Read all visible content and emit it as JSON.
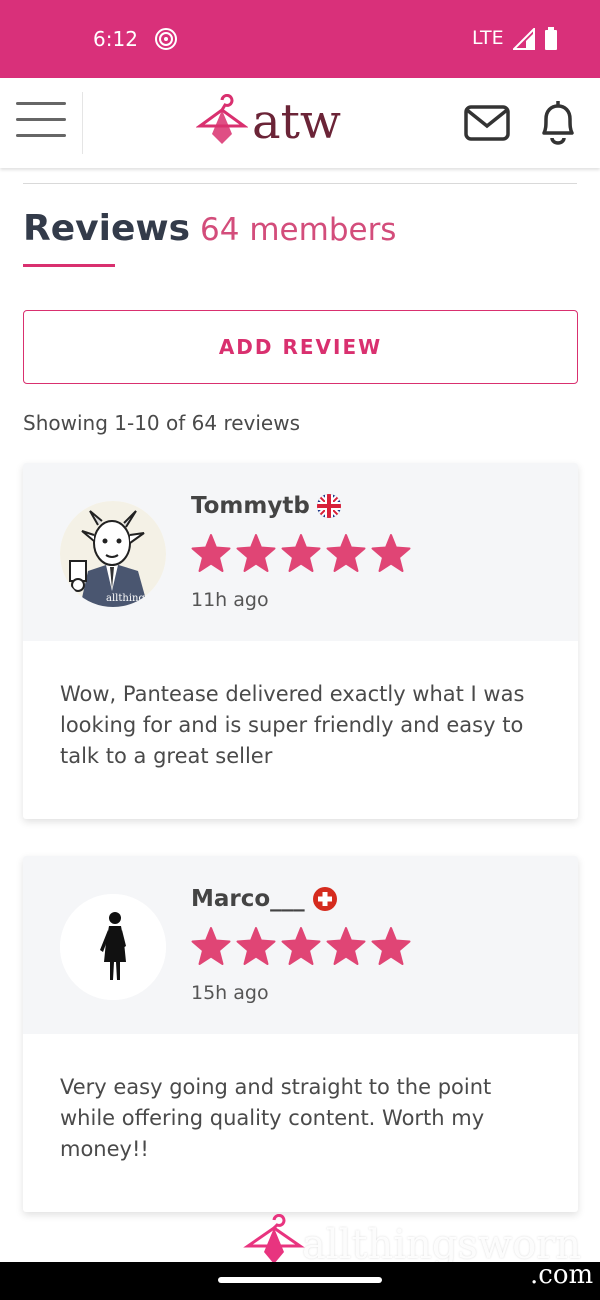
{
  "status_bar": {
    "time": "6:12",
    "network": "LTE"
  },
  "header": {
    "logo_text": "atw"
  },
  "page": {
    "title": "Reviews",
    "member_count": "64 members",
    "add_review_label": "ADD REVIEW",
    "showing_text": "Showing 1-10 of 64 reviews"
  },
  "reviews": [
    {
      "name": "Tommytb",
      "flag": "uk-flag-icon",
      "rating": 5,
      "time": "11h ago",
      "text": "Wow, Pantease delivered exactly what I was looking for and is super friendly and easy to talk to a great seller"
    },
    {
      "name": "Marco___",
      "flag": "swiss-flag-icon",
      "rating": 5,
      "time": "15h ago",
      "text": "Very easy going and straight to the point while offering quality content. Worth my money!!"
    }
  ],
  "watermark": {
    "text": "allthingsworn",
    "suffix": ".com"
  },
  "colors": {
    "brand_pink": "#d9307a",
    "accent": "#d9306f",
    "star": "#e04575",
    "logo_maroon": "#6b2437"
  }
}
